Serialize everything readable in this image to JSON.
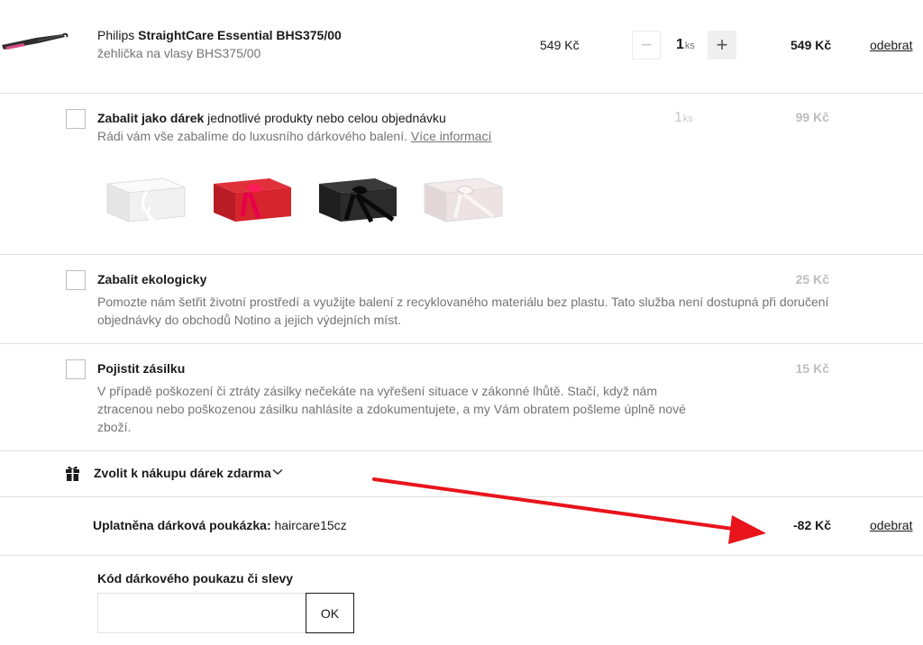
{
  "product": {
    "brand": "Philips",
    "name": "StraightCare Essential BHS375/00",
    "subtitle": "žehlička na vlasy BHS375/00",
    "unit_price": "549 Kč",
    "quantity": "1",
    "quantity_unit": "ks",
    "minus_label": "−",
    "plus_label": "+",
    "total": "549 Kč",
    "remove_label": "odebrat"
  },
  "gift_wrap": {
    "title_bold": "Zabalit jako dárek",
    "title_rest": " jednotlivé produkty nebo celou objednávku",
    "description": "Rádi vám vše zabalíme do luxusního dárkového balení.",
    "more_info_link": "Více informací",
    "quantity": "1",
    "quantity_unit": "ks",
    "price": "99 Kč",
    "options": [
      {
        "name": "white",
        "box_color": "#f1f1f1",
        "ribbon_color": "#ffffff"
      },
      {
        "name": "red",
        "box_color": "#d7252d",
        "ribbon_color": "#e8004a"
      },
      {
        "name": "black",
        "box_color": "#2b2b2b",
        "ribbon_color": "#0a0a0a"
      },
      {
        "name": "pink",
        "box_color": "#ede2e4",
        "ribbon_color": "#f7f1f2"
      }
    ]
  },
  "eco_wrap": {
    "title": "Zabalit ekologicky",
    "description": "Pomozte nám šetřit životní prostředí a využijte balení z recyklovaného materiálu bez plastu. Tato služba není dostupná při doručení objednávky do obchodů Notino a jejich výdejních míst.",
    "price": "25 Kč"
  },
  "insurance": {
    "title": "Pojistit zásilku",
    "description": "V případě poškození či ztráty zásilky nečekáte na vyřešení situace v zákonné lhůtě. Stačí, když nám ztracenou nebo poškozenou zásilku nahlásíte a zdokumentujete, a my Vám obratem pošleme úplně nové zboží.",
    "price": "15 Kč"
  },
  "free_gift": {
    "label": "Zvolit k nákupu dárek zdarma"
  },
  "voucher": {
    "label": "Uplatněna dárková poukázka:",
    "code": " haircare15cz",
    "amount": "-82 Kč",
    "remove_label": "odebrat"
  },
  "code_form": {
    "label": "Kód dárkového poukazu či slevy",
    "input_value": "",
    "input_placeholder": "",
    "ok_label": "OK"
  },
  "colors": {
    "annotation_arrow": "#e8141b",
    "text_primary": "#1a1a1a",
    "text_muted": "#747474",
    "price_disabled": "#bdbdbd"
  },
  "icons": {
    "gift": "gift-icon",
    "chevron": "chevron-down-icon",
    "product": "hair-straightener-image"
  }
}
